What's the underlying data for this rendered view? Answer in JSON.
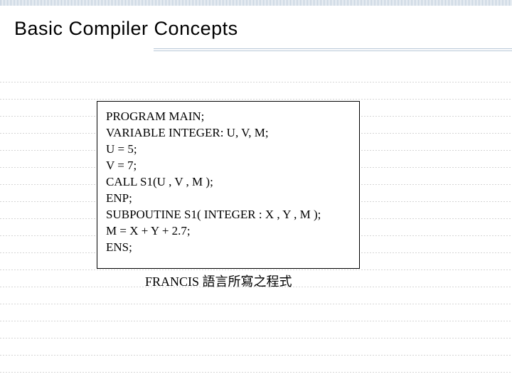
{
  "title": "Basic Compiler Concepts",
  "code": {
    "line1": "PROGRAM MAIN;",
    "line2": "VARIABLE INTEGER: U, V, M;",
    "line3": "U = 5;",
    "line4": "V = 7;",
    "line5": "CALL   S1(U , V , M );",
    "line6": "ENP;",
    "line7": "SUBPOUTINE  S1( INTEGER : X , Y , M );",
    "line8": "M = X + Y + 2.7;",
    "line9": "ENS;"
  },
  "caption": "FRANCIS 語言所寫之程式",
  "hline_positions": [
    115,
    139,
    163,
    187,
    211,
    235,
    259,
    283,
    307,
    331,
    355,
    379,
    403,
    427,
    451,
    475,
    499,
    523
  ]
}
